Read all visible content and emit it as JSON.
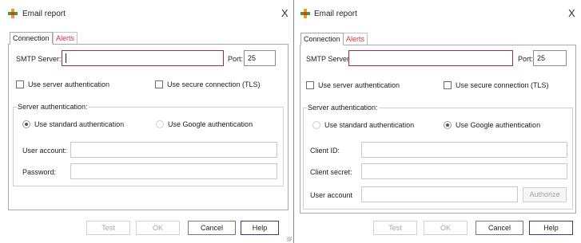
{
  "colors": {
    "smtp_border": "#9e2d4a",
    "alerts_tab": "#d13438",
    "help_border": "#3b3b7a"
  },
  "left": {
    "title": "Email report",
    "close": "X",
    "tabs": [
      "Connection",
      "Alerts"
    ],
    "smtp_label": "SMTP Server:",
    "smtp_value": "",
    "port_label": "Port:",
    "port_value": "25",
    "checkbox_server_auth": "Use server authentication",
    "checkbox_tls": "Use secure connection (TLS)",
    "group_title": "Server authentication:",
    "radio_standard": "Use standard authentication",
    "radio_google": "Use Google authentication",
    "selected_auth": "standard",
    "user_account_label": "User account:",
    "password_label": "Password:",
    "buttons": {
      "test": "Test",
      "ok": "OK",
      "cancel": "Cancel",
      "help": "Help"
    }
  },
  "right": {
    "title": "Email report",
    "close": "X",
    "tabs": [
      "Connection",
      "Alerts"
    ],
    "smtp_label": "SMTP Server:",
    "smtp_value": "",
    "port_label": "Port:",
    "port_value": "25",
    "checkbox_server_auth": "Use server authentication",
    "checkbox_tls": "Use secure connection (TLS)",
    "group_title": "Server authentication:",
    "radio_standard": "Use standard authentication",
    "radio_google": "Use Google authentication",
    "selected_auth": "google",
    "client_id_label": "Client ID:",
    "client_secret_label": "Client secret:",
    "user_account_label": "User account",
    "authorize_button": "Authorize",
    "buttons": {
      "test": "Test",
      "ok": "OK",
      "cancel": "Cancel",
      "help": "Help"
    }
  }
}
